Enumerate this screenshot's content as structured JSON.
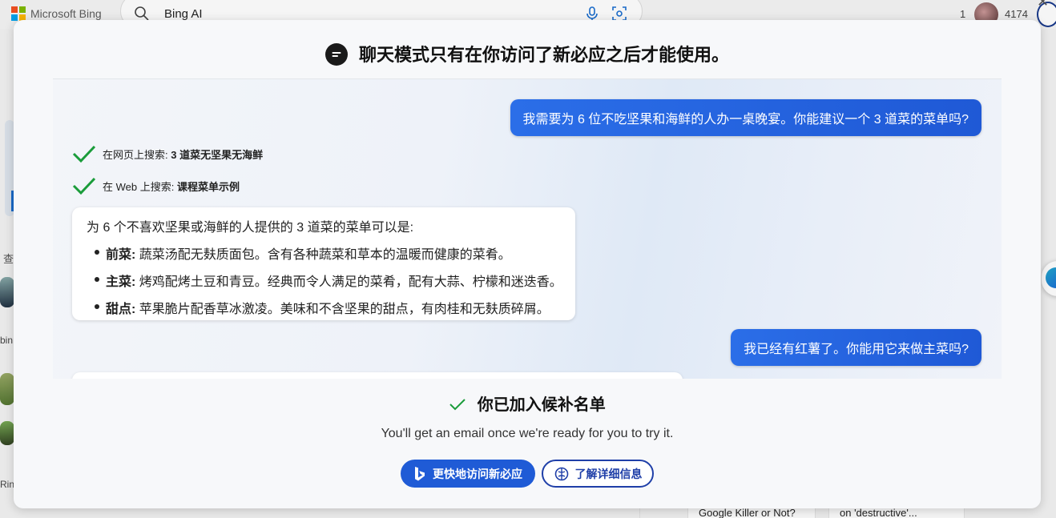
{
  "header": {
    "brand": "Microsoft Bing",
    "search_query": "Bing AI",
    "points_count": "1",
    "rewards_count": "4174"
  },
  "background": {
    "side_text_1": "查",
    "side_text_2": "bin",
    "side_text_3": "Rin",
    "news_1": "Google Killer or Not?",
    "news_2": "on 'destructive'..."
  },
  "modal": {
    "title": "聊天模式只有在你访问了新必应之后才能使用。",
    "preview": {
      "user_message_1": "我需要为 6 位不吃坚果和海鲜的人办一桌晚宴。你能建议一个 3 道菜的菜单吗?",
      "search_step_1_prefix": "在网页上搜索: ",
      "search_step_1_query": "3 道菜无坚果无海鲜",
      "search_step_2_prefix": "在 Web 上搜索: ",
      "search_step_2_query": "课程菜单示例",
      "bot_intro": "为 6 个不喜欢坚果或海鲜的人提供的 3 道菜的菜单可以是:",
      "bot_items": [
        {
          "label": "前菜:",
          "text": " 蔬菜汤配无麸质面包。含有各种蔬菜和草本的温暖而健康的菜肴。"
        },
        {
          "label": "主菜:",
          "text": " 烤鸡配烤土豆和青豆。经典而令人满足的菜肴，配有大蒜、柠檬和迷迭香。"
        },
        {
          "label": "甜点:",
          "text": " 苹果脆片配香草冰激凌。美味和不含坚果的甜点，有肉桂和无麸质碎屑。"
        }
      ],
      "user_message_2": "我已经有红薯了。你能用它来做主菜吗?"
    },
    "waitlist_heading": "你已加入候补名单",
    "email_note": "You'll get an email once we're ready for you to try it.",
    "primary_button": "更快地访问新必应",
    "secondary_button": "了解详细信息"
  },
  "colors": {
    "accent": "#1f5bd6",
    "check_green": "#1a9c3a"
  }
}
